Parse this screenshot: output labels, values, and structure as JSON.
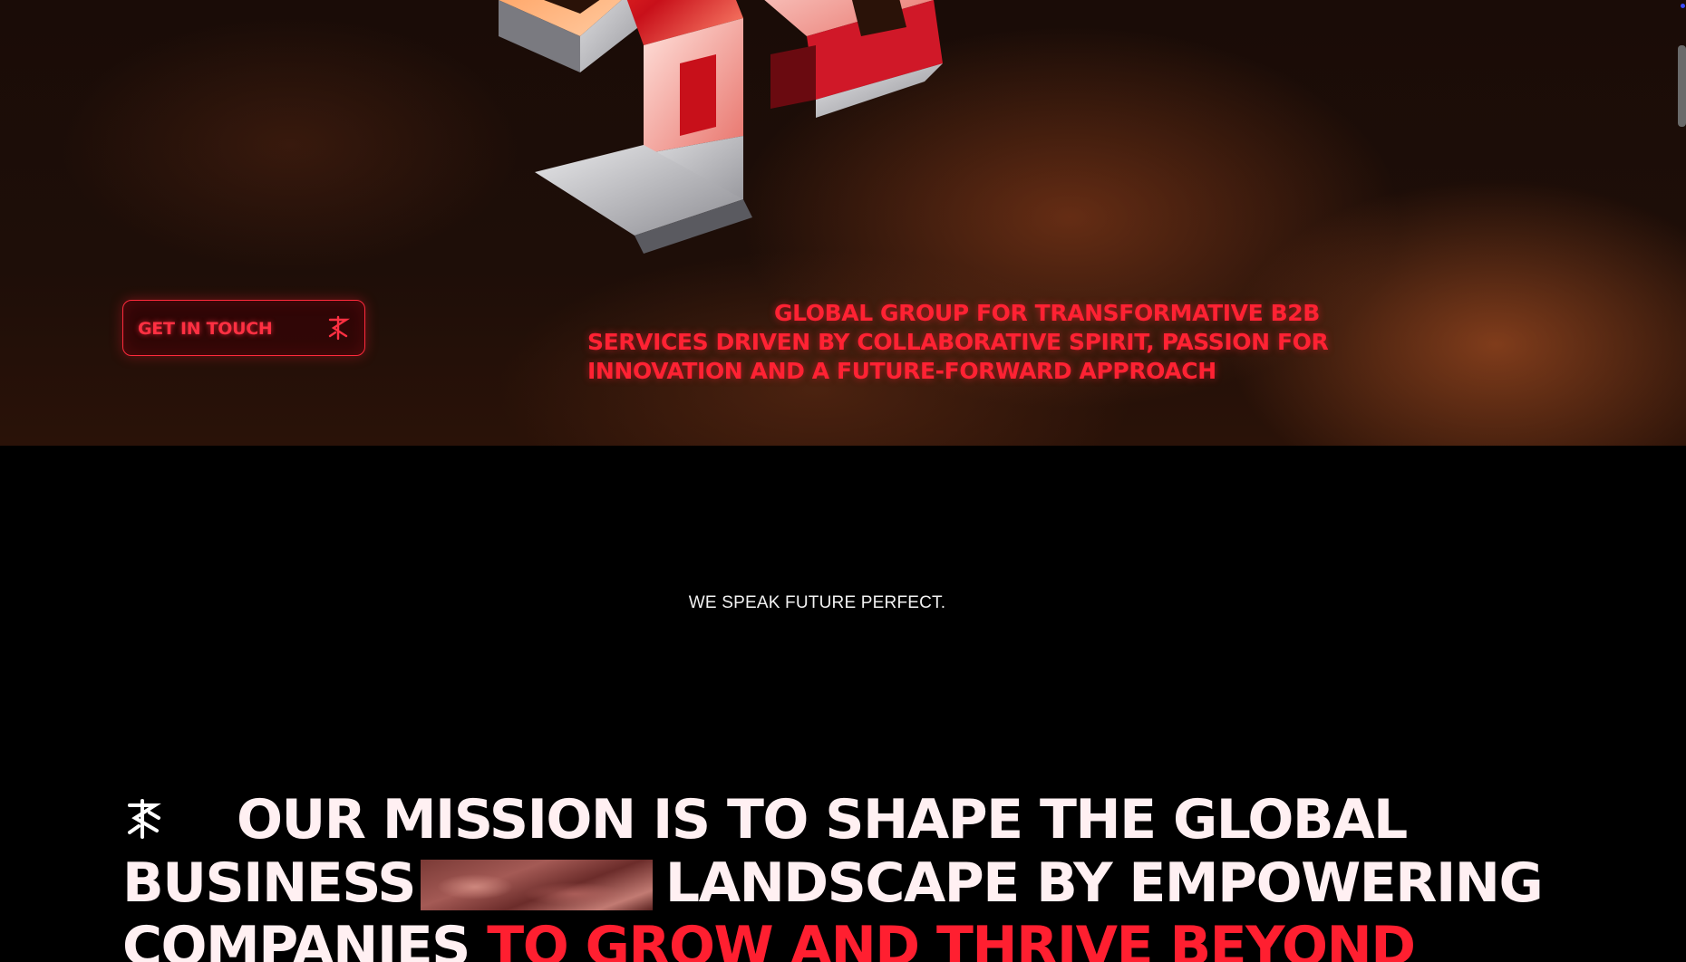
{
  "hero": {
    "cta_label": "GET IN TOUCH",
    "cta_icon": "brand-mark-icon",
    "tagline": "GLOBAL GROUP FOR TRANSFORMATIVE B2B SERVICES DRIVEN BY COLLABORATIVE SPIRIT, PASSION FOR INNOVATION AND A FUTURE-FORWARD APPROACH"
  },
  "statement": {
    "text": "WE SPEAK FUTURE PERFECT."
  },
  "mission": {
    "icon": "brand-mark-icon",
    "line1": "OUR MISSION IS TO SHAPE THE GLOBAL",
    "line2_before": "BUSINESS",
    "line2_after": "LANDSCAPE BY EMPOWERING",
    "line3_white": "COMPANIES",
    "line3_accent": "TO GROW AND THRIVE BEYOND"
  },
  "colors": {
    "accent": "#ff1f30",
    "background": "#000000",
    "text": "#fff0f2"
  }
}
